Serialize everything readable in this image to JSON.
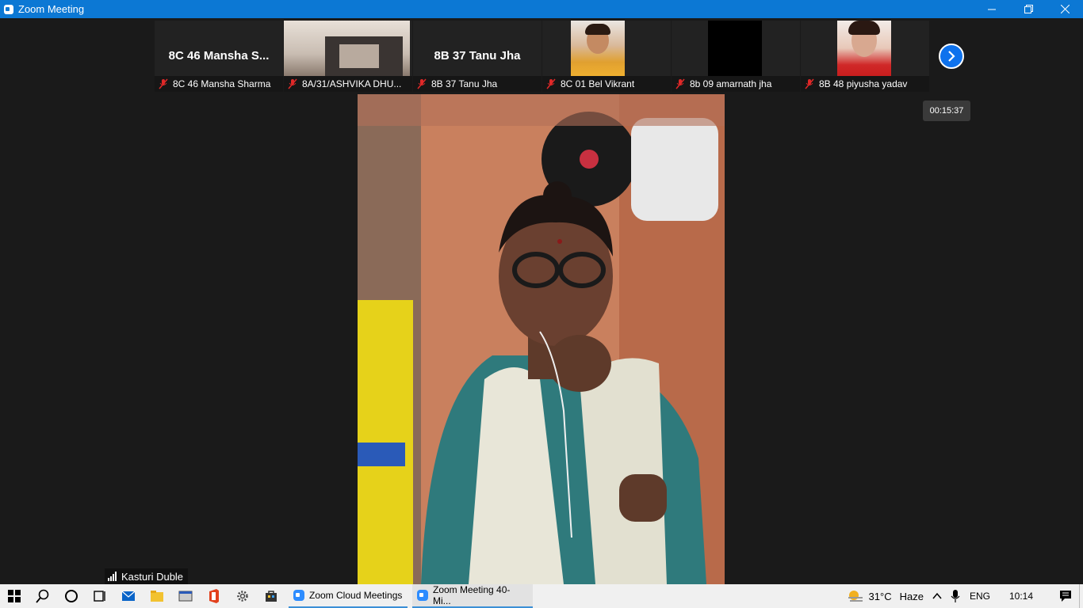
{
  "window": {
    "title": "Zoom Meeting",
    "controls": {
      "minimize": "—",
      "restore": "❐",
      "close": "✕"
    }
  },
  "participants": [
    {
      "tile_text": "8C 46 Mansha S...",
      "label": "8C 46 Mansha Sharma",
      "video": false,
      "muted": true
    },
    {
      "tile_text": "",
      "label": "8A/31/ASHVIKA DHU...",
      "video": true,
      "muted": true
    },
    {
      "tile_text": "8B 37 Tanu Jha",
      "label": "8B 37 Tanu Jha",
      "video": false,
      "muted": true
    },
    {
      "tile_text": "",
      "label": "8C 01 Bel Vikrant",
      "video": true,
      "muted": true
    },
    {
      "tile_text": "",
      "label": "8b 09 amarnath jha",
      "video": true,
      "muted": true
    },
    {
      "tile_text": "",
      "label": "8B 48 piyusha yadav",
      "video": true,
      "muted": true
    }
  ],
  "timer": "00:15:37",
  "active_speaker": {
    "name": "Kasturi Duble"
  },
  "taskbar": {
    "apps": [
      {
        "label": "Zoom Cloud Meetings"
      },
      {
        "label": "Zoom Meeting 40-Mi..."
      }
    ],
    "weather": {
      "temp": "31°C",
      "condition": "Haze"
    },
    "language": "ENG",
    "time": "10:14"
  },
  "colors": {
    "titlebar": "#0c78d4",
    "zoom_blue": "#0e72ed",
    "mute_red": "#e02828"
  },
  "icons": {
    "next": "chevron-right-icon",
    "mute": "microphone-muted-icon",
    "signal": "signal-strength-icon"
  }
}
